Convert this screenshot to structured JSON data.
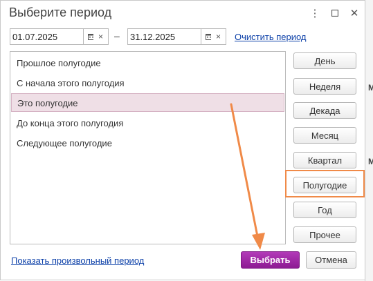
{
  "dialog": {
    "title": "Выберите период",
    "menu_icon": "vertical-dots-icon",
    "maximize_icon": "maximize-icon",
    "close_icon": "close-icon"
  },
  "period": {
    "start_date": "01.07.2025",
    "end_date": "31.12.2025",
    "separator": "–",
    "clear_link": "Очистить период",
    "clear_icon_glyph": "×"
  },
  "presets": {
    "items": [
      {
        "label": "Прошлое полугодие",
        "selected": false
      },
      {
        "label": "С начала этого полугодия",
        "selected": false
      },
      {
        "label": "Это полугодие",
        "selected": true
      },
      {
        "label": "До конца этого полугодия",
        "selected": false
      },
      {
        "label": "Следующее полугодие",
        "selected": false
      }
    ]
  },
  "period_types": {
    "day": "День",
    "week": "Неделя",
    "decade": "Декада",
    "month": "Месяц",
    "quarter": "Квартал",
    "half_year": "Полугодие",
    "year": "Год",
    "other": "Прочее"
  },
  "footer": {
    "custom_link": "Показать произвольный период",
    "select_label": "Выбрать",
    "cancel_label": "Отмена"
  },
  "colors": {
    "accent": "#9b259f",
    "annotation": "#f08a48",
    "selection": "#efdfe6",
    "link": "#0b3fa8"
  }
}
